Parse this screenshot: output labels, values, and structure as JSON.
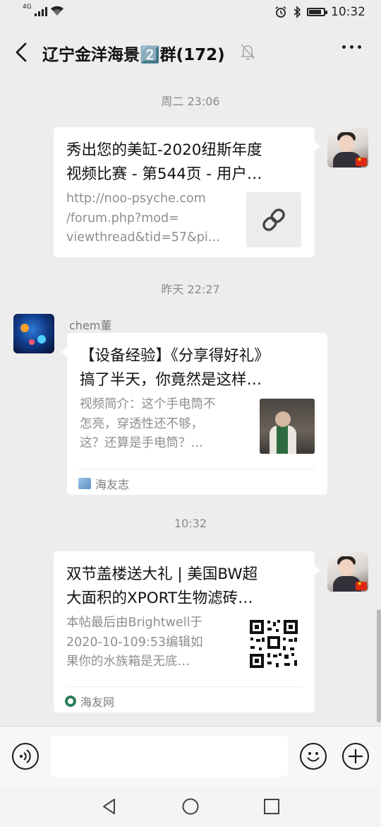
{
  "status_bar": {
    "network": "4G",
    "time": "10:32",
    "battery_level": 0.85
  },
  "header": {
    "title": "辽宁金洋海景2️⃣群(172)",
    "back_icon": "chevron-left-icon",
    "mute_icon": "bell-off-icon",
    "more_icon": "more-icon"
  },
  "messages": [
    {
      "time": "周二 23:06",
      "side": "right",
      "title": "秀出您的美缸-2020纽斯年度\n视频比赛 - 第544页 - 用户…",
      "description": "http://noo-psyche.com\n/forum.php?mod=\nviewthread&tid=57&pi…",
      "thumb": "link-icon"
    },
    {
      "time": "昨天 22:27",
      "side": "left",
      "sender": "chem董",
      "title": "【设备经验】《分享得好礼》\n搞了半天，你竟然是这样…",
      "description": "视频简介：这个手电筒不\n怎亮，穿透性还不够，\n这？还算是手电筒？…",
      "thumb": "video-thumbnail",
      "source": "海友志"
    },
    {
      "time": "10:32",
      "side": "right",
      "title": "双节盖楼送大礼 | 美国BW超\n大面积的XPORT生物滤砖…",
      "description": "本帖最后由Brightwell于\n2020-10-109:53编辑如\n果你的水族箱是无底…",
      "thumb": "qr-code",
      "source": "海友网"
    }
  ],
  "input": {
    "voice_icon": "voice-icon",
    "text_value": "",
    "emoji_icon": "emoji-icon",
    "add_icon": "plus-icon"
  },
  "nav": {
    "back": "triangle-back-icon",
    "home": "circle-home-icon",
    "recent": "square-recent-icon"
  }
}
